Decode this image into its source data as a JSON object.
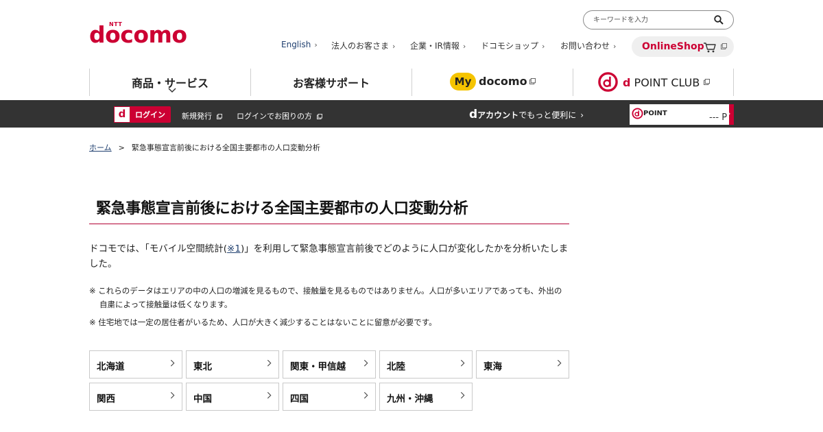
{
  "header": {
    "logo": {
      "ntt": "NTT",
      "wordmark": "docomo"
    },
    "search": {
      "placeholder": "キーワードを入力"
    },
    "util_links": [
      "English",
      "法人のお客さま",
      "企業・IR情報",
      "ドコモショップ",
      "お問い合わせ"
    ],
    "online_shop": "OnlineShop",
    "gnav": {
      "products": "商品・サービス",
      "support": "お客様サポート",
      "my_badge": "My",
      "my_word": "docomo",
      "dpoint_d": "d",
      "dpoint_word": "POINT CLUB"
    }
  },
  "account_bar": {
    "login_icon": "d",
    "login_label": "ログイン",
    "signup": "新規発行",
    "trouble": "ログインでお困りの方",
    "daccount_d": "d",
    "daccount_word": "アカウント",
    "daccount_tail": "でもっと便利に",
    "dpoint_label": "POINT",
    "dpoint_value": "--- P"
  },
  "breadcrumb": {
    "home": "ホーム",
    "separator": ">",
    "current": "緊急事態宣言前後における全国主要都市の人口変動分析"
  },
  "page": {
    "title": "緊急事態宣言前後における全国主要都市の人口変動分析",
    "intro_before": "ドコモでは、「モバイル空間統計(",
    "intro_link": "※1",
    "intro_after": ")」を利用して緊急事態宣言前後でどのように人口が変化したかを分析いたしました。",
    "notes": [
      "※ これらのデータはエリアの中の人口の増減を見るもので、接触量を見るものではありません。人口が多いエリアであっても、外出の自粛によって接触量は低くなります。",
      "※ 住宅地では一定の居住者がいるため、人口が大きく減少することはないことに留意が必要です。"
    ],
    "regions": [
      "北海道",
      "東北",
      "関東・甲信越",
      "北陸",
      "東海",
      "関西",
      "中国",
      "四国",
      "九州・沖縄"
    ]
  },
  "colors": {
    "brand": "#cc0033",
    "bar": "#333333",
    "my_badge": "#f5c400",
    "link": "#1f3f6f"
  },
  "icons": [
    "search-icon",
    "cart-icon",
    "external-link-icon",
    "chevron-right-icon",
    "chevron-down-icon"
  ]
}
